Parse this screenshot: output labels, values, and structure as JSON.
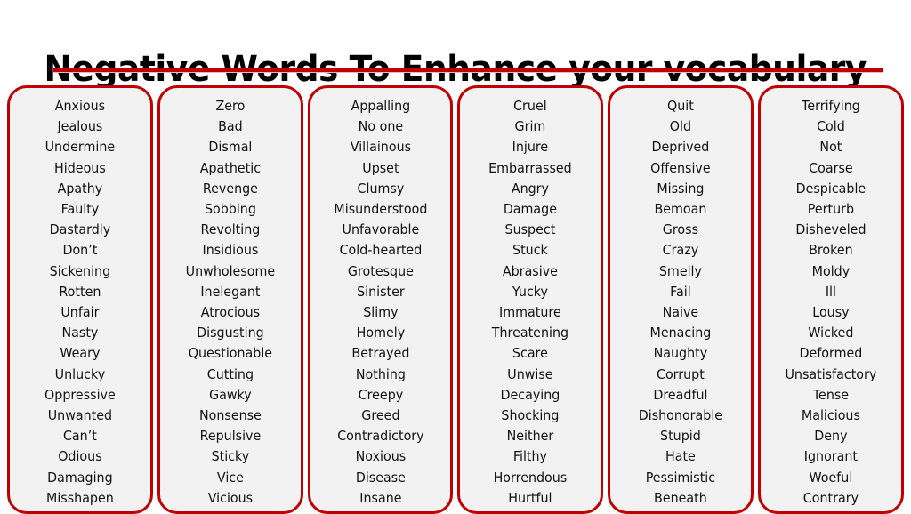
{
  "header": {
    "title": "Negative Words To Enhance your vocabulary",
    "underline_color": "#C00000"
  },
  "theme": {
    "card_border_color": "#C00000",
    "card_fill_color": "#F2F2F2",
    "text_color": "#111111",
    "background_color": "#FFFFFF"
  },
  "columns": [
    {
      "index": 1,
      "words": [
        "Anxious",
        "Jealous",
        "Undermine",
        "Hideous",
        "Apathy",
        "Faulty",
        "Dastardly",
        "Don’t",
        "Sickening",
        "Rotten",
        "Unfair",
        "Nasty",
        "Weary",
        "Unlucky",
        "Oppressive",
        "Unwanted",
        "Can’t",
        "Odious",
        "Damaging",
        "Misshapen"
      ]
    },
    {
      "index": 2,
      "words": [
        "Zero",
        "Bad",
        "Dismal",
        "Apathetic",
        "Revenge",
        "Sobbing",
        "Revolting",
        "Insidious",
        "Unwholesome",
        "Inelegant",
        "Atrocious",
        "Disgusting",
        "Questionable",
        "Cutting",
        "Gawky",
        "Nonsense",
        "Repulsive",
        "Sticky",
        "Vice",
        "Vicious"
      ]
    },
    {
      "index": 3,
      "words": [
        "Appalling",
        "No one",
        "Villainous",
        "Upset",
        "Clumsy",
        "Misunderstood",
        "Unfavorable",
        "Cold-hearted",
        "Grotesque",
        "Sinister",
        "Slimy",
        "Homely",
        "Betrayed",
        "Nothing",
        "Creepy",
        "Greed",
        "Contradictory",
        "Noxious",
        "Disease",
        "Insane"
      ]
    },
    {
      "index": 4,
      "words": [
        "Cruel",
        "Grim",
        "Injure",
        "Embarrassed",
        "Angry",
        "Damage",
        "Suspect",
        "Stuck",
        "Abrasive",
        "Yucky",
        "Immature",
        "Threatening",
        "Scare",
        "Unwise",
        "Decaying",
        "Shocking",
        "Neither",
        "Filthy",
        "Horrendous",
        "Hurtful"
      ]
    },
    {
      "index": 5,
      "words": [
        "Quit",
        "Old",
        "Deprived",
        "Offensive",
        "Missing",
        "Bemoan",
        "Gross",
        "Crazy",
        "Smelly",
        "Fail",
        "Naive",
        "Menacing",
        "Naughty",
        "Corrupt",
        "Dreadful",
        "Dishonorable",
        "Stupid",
        "Hate",
        "Pessimistic",
        "Beneath"
      ]
    },
    {
      "index": 6,
      "words": [
        "Terrifying",
        "Cold",
        "Not",
        "Coarse",
        "Despicable",
        "Perturb",
        "Disheveled",
        "Broken",
        "Moldy",
        "Ill",
        "Lousy",
        "Wicked",
        "Deformed",
        "Unsatisfactory",
        "Tense",
        "Malicious",
        "Deny",
        "Ignorant",
        "Woeful",
        "Contrary"
      ]
    }
  ]
}
